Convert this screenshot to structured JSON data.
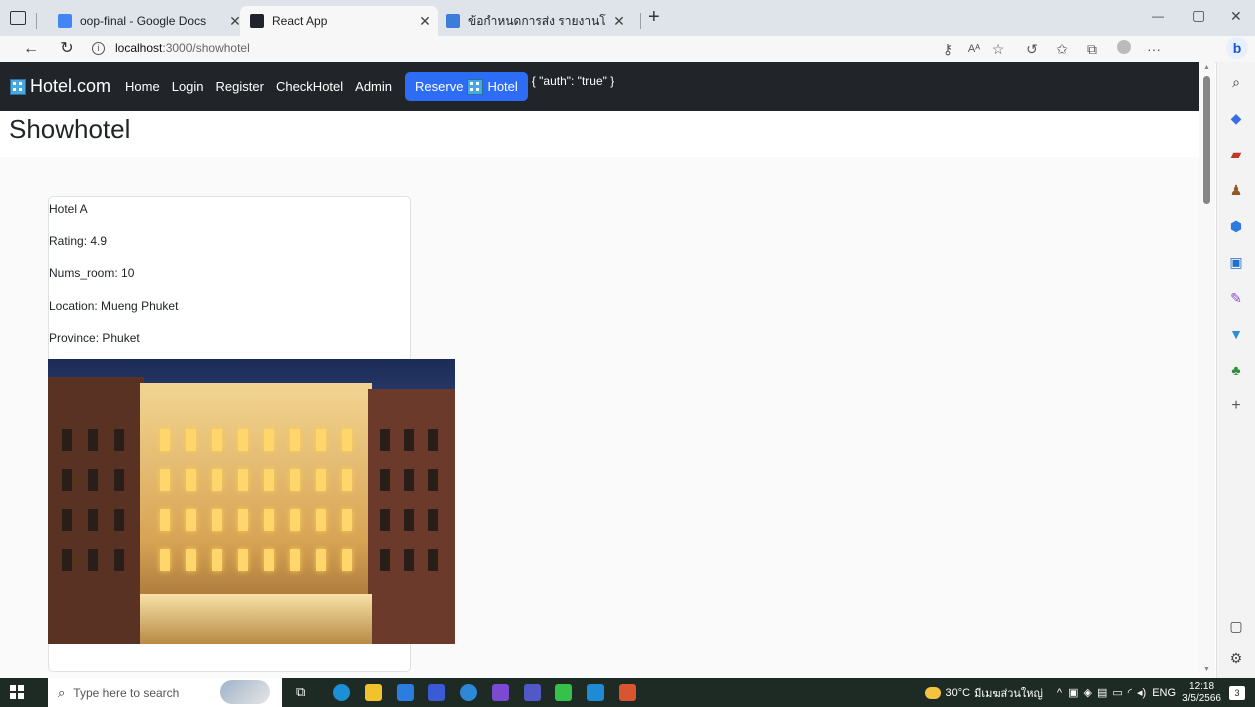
{
  "browser": {
    "tabs": [
      {
        "title": "oop-final - Google Docs",
        "active": false,
        "color": "#4285f4"
      },
      {
        "title": "React App",
        "active": true,
        "color": "#20232a"
      },
      {
        "title": "ข้อกำหนดการส่ง รายงานโครงงาน OO",
        "active": false,
        "color": "#3b7dd8"
      }
    ],
    "new_tab": "+",
    "url_host": "localhost",
    "url_path": ":3000/showhotel",
    "window_controls": {
      "minimize": "—",
      "maximize": "▢",
      "close": "✕"
    }
  },
  "navbar": {
    "brand": "Hotel.com",
    "links": [
      "Home",
      "Login",
      "Register",
      "CheckHotel",
      "Admin"
    ],
    "reserve_prefix": "Reserve",
    "reserve_suffix": "Hotel",
    "auth_text": "{ \"auth\": \"true\" }"
  },
  "page": {
    "title": "Showhotel"
  },
  "hotel": {
    "name": "Hotel A",
    "rating": "Rating: 4.9",
    "nums_room": "Nums_room: 10",
    "location": "Location: Mueng Phuket",
    "province": "Province: Phuket"
  },
  "taskbar": {
    "search_placeholder": "Type here to search",
    "weather": "30°C",
    "weather_desc": "มีเมฆส่วนใหญ่",
    "lang": "ENG",
    "time": "12:18",
    "date": "3/5/2566",
    "notif_count": "3"
  },
  "colors": {
    "navbar_bg": "#212529",
    "reserve_btn": "#2d6df6",
    "taskbar_bg": "#1e2a24"
  }
}
